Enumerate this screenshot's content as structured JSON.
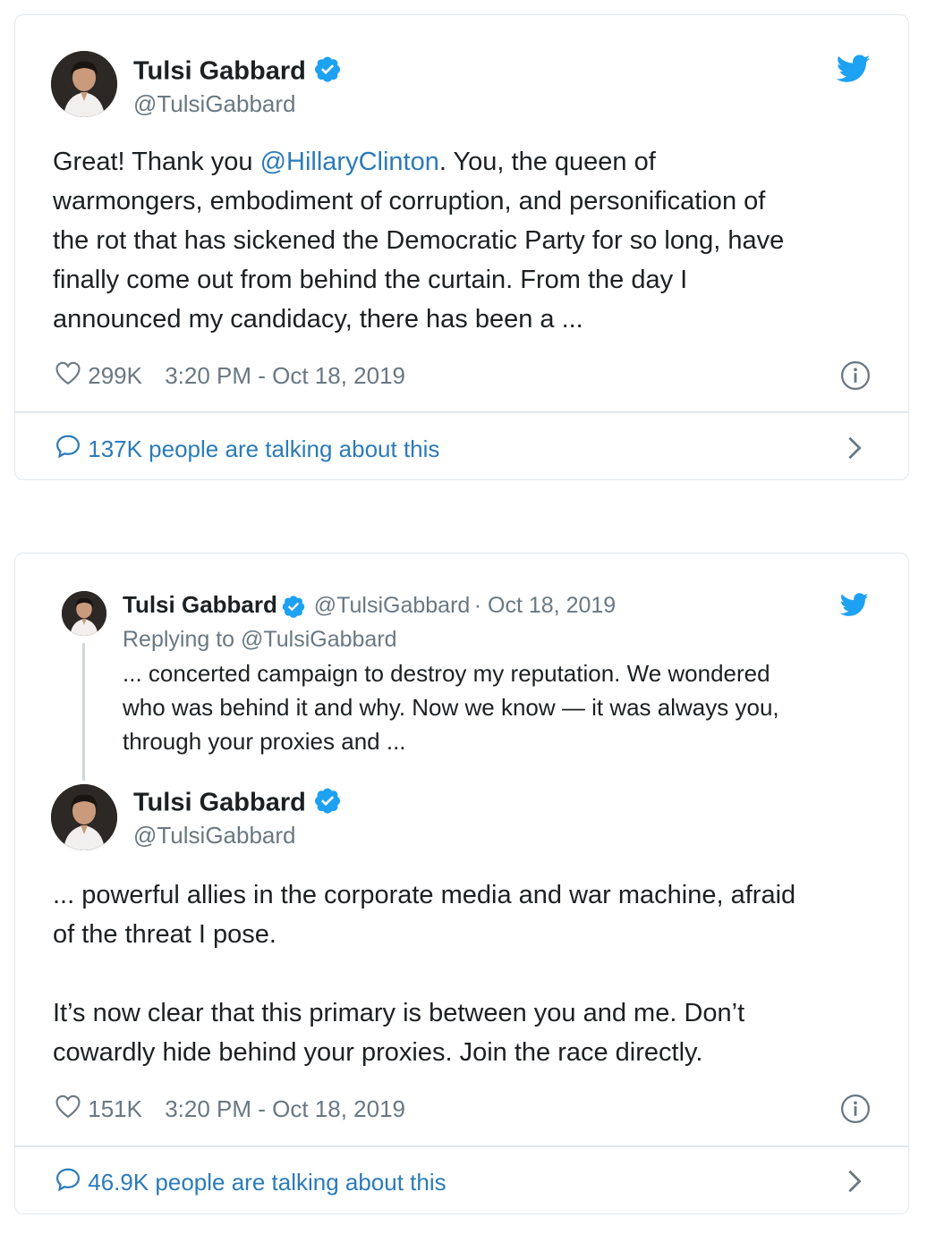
{
  "tweet1": {
    "author": {
      "name": "Tulsi Gabbard",
      "handle": "@TulsiGabbard",
      "avatar_icon": "profile-photo",
      "verified_icon": "verified-badge-icon"
    },
    "body_lines": [
      {
        "pre": "Great! Thank you ",
        "mention": "@HillaryClinton",
        "post": ". You, the queen of"
      },
      "warmongers, embodiment of corruption, and personification of",
      "the rot that has sickened the Democratic Party for so long, have",
      "finally come out from behind the curtain. From the day I",
      "announced my candidacy, there has been a ..."
    ],
    "likes": "299K",
    "timestamp": "3:20 PM - Oct 18, 2019",
    "talking": "137K people are talking about this"
  },
  "tweet2": {
    "quoted": {
      "name": "Tulsi Gabbard",
      "handle": "@TulsiGabbard",
      "date": "· Oct 18, 2019",
      "replying_to": "Replying to @TulsiGabbard",
      "lines": [
        "... concerted campaign to destroy my reputation. We wondered",
        "who was behind it and why. Now we know — it was always you,",
        "through your proxies and ..."
      ]
    },
    "author": {
      "name": "Tulsi Gabbard",
      "handle": "@TulsiGabbard"
    },
    "body_lines": [
      "... powerful allies in the corporate media and war machine, afraid",
      "of the threat I pose.",
      "",
      "It’s now clear that this primary is between you and me. Don’t",
      "cowardly hide behind your proxies. Join the race directly."
    ],
    "likes": "151K",
    "timestamp": "3:20 PM - Oct 18, 2019",
    "talking": "46.9K people are talking about this"
  },
  "icons": {
    "twitter": "twitter-bird-icon",
    "heart": "heart-icon",
    "info": "info-icon",
    "chat": "chat-bubble-icon",
    "chevron": "chevron-right-icon"
  },
  "colors": {
    "link": "#2b7bb9",
    "twitter_blue": "#1da1f2",
    "muted": "#697882",
    "text": "#1c2022",
    "border": "#e1e8ed"
  }
}
